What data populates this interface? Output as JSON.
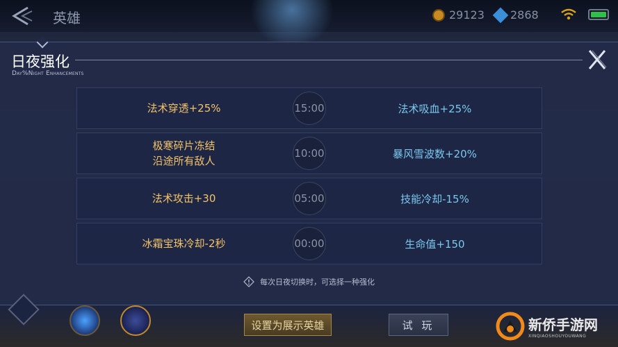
{
  "header": {
    "title": "英雄",
    "gold": "29123",
    "gems": "2868"
  },
  "panel": {
    "title": "日夜强化",
    "subtitle": "Day%Night Enhancements",
    "rows": [
      {
        "left": "法术穿透+25%",
        "time": "15:00",
        "right": "法术吸血+25%"
      },
      {
        "left": "极寒碎片冻结\n沿途所有敌人",
        "time": "10:00",
        "right": "暴风雪波数+20%"
      },
      {
        "left": "法术攻击+30",
        "time": "05:00",
        "right": "技能冷却-15%"
      },
      {
        "left": "冰霜宝珠冷却-2秒",
        "time": "00:00",
        "right": "生命值+150"
      }
    ],
    "hint": "每次日夜切换时，可选择一种强化"
  },
  "bottom": {
    "showcase_label": "设置为展示英雄",
    "try_label": "试 玩"
  },
  "watermark": {
    "name": "新侨手游网",
    "domain": "XINQIAOSHOUYOUWANG"
  },
  "colors": {
    "buff_left": "#f3c36a",
    "buff_right": "#7cc8ee",
    "panel_bg": "#222a48"
  },
  "icons": [
    "back-arrow-icon",
    "coin-icon",
    "gem-icon",
    "wifi-icon",
    "battery-icon",
    "close-icon",
    "info-diamond-icon",
    "watermark-logo-icon"
  ]
}
